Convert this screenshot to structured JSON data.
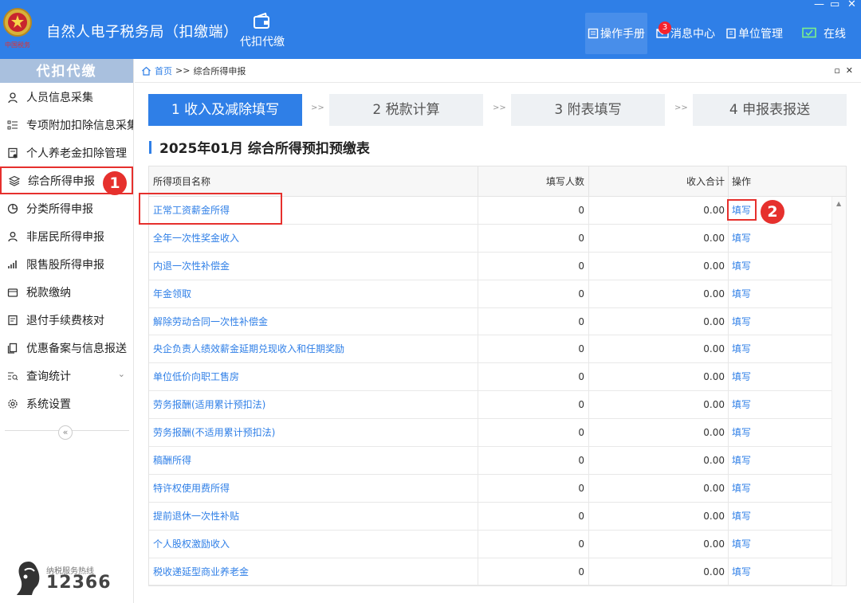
{
  "header": {
    "title": "自然人电子税务局（扣缴端）",
    "module_label": "代扣代缴",
    "manual_label": "操作手册",
    "message_label": "消息中心",
    "message_badge": "3",
    "unit_label": "单位管理",
    "online_label": "在线",
    "emblem_text": "中国税务"
  },
  "sidebar": {
    "title": "代扣代缴",
    "items": [
      {
        "label": "人员信息采集",
        "icon": "person-icon"
      },
      {
        "label": "专项附加扣除信息采集",
        "icon": "list-icon"
      },
      {
        "label": "个人养老金扣除管理",
        "icon": "pension-icon"
      },
      {
        "label": "综合所得申报",
        "icon": "layers-icon"
      },
      {
        "label": "分类所得申报",
        "icon": "pie-icon"
      },
      {
        "label": "非居民所得申报",
        "icon": "user-icon"
      },
      {
        "label": "限售股所得申报",
        "icon": "bar-chart-icon"
      },
      {
        "label": "税款缴纳",
        "icon": "wallet-icon"
      },
      {
        "label": "退付手续费核对",
        "icon": "document-icon"
      },
      {
        "label": "优惠备案与信息报送",
        "icon": "copy-icon"
      },
      {
        "label": "查询统计",
        "icon": "search-list-icon"
      },
      {
        "label": "系统设置",
        "icon": "gear-icon"
      }
    ],
    "collapse_glyph": "«",
    "hotline_label": "纳税服务热线",
    "hotline_number": "12366"
  },
  "markers": {
    "first": "1",
    "second": "2"
  },
  "breadcrumb": {
    "home": "首页",
    "separator": ">>",
    "current": "综合所得申报"
  },
  "steps": [
    {
      "label": "1 收入及减除填写",
      "active": true
    },
    {
      "label": "2 税款计算",
      "active": false
    },
    {
      "label": "3 附表填写",
      "active": false
    },
    {
      "label": "4 申报表报送",
      "active": false
    }
  ],
  "step_separator": ">>",
  "table": {
    "title": "2025年01月  综合所得预扣预缴表",
    "columns": [
      "所得项目名称",
      "填写人数",
      "收入合计",
      "操作"
    ],
    "rows": [
      {
        "name": "正常工资薪金所得",
        "count": "0",
        "income": "0.00",
        "action": "填写"
      },
      {
        "name": "全年一次性奖金收入",
        "count": "0",
        "income": "0.00",
        "action": "填写"
      },
      {
        "name": "内退一次性补偿金",
        "count": "0",
        "income": "0.00",
        "action": "填写"
      },
      {
        "name": "年金领取",
        "count": "0",
        "income": "0.00",
        "action": "填写"
      },
      {
        "name": "解除劳动合同一次性补偿金",
        "count": "0",
        "income": "0.00",
        "action": "填写"
      },
      {
        "name": "央企负责人绩效薪金延期兑现收入和任期奖励",
        "count": "0",
        "income": "0.00",
        "action": "填写"
      },
      {
        "name": "单位低价向职工售房",
        "count": "0",
        "income": "0.00",
        "action": "填写"
      },
      {
        "name": "劳务报酬(适用累计预扣法)",
        "count": "0",
        "income": "0.00",
        "action": "填写"
      },
      {
        "name": "劳务报酬(不适用累计预扣法)",
        "count": "0",
        "income": "0.00",
        "action": "填写"
      },
      {
        "name": "稿酬所得",
        "count": "0",
        "income": "0.00",
        "action": "填写"
      },
      {
        "name": "特许权使用费所得",
        "count": "0",
        "income": "0.00",
        "action": "填写"
      },
      {
        "name": "提前退休一次性补贴",
        "count": "0",
        "income": "0.00",
        "action": "填写"
      },
      {
        "name": "个人股权激励收入",
        "count": "0",
        "income": "0.00",
        "action": "填写"
      },
      {
        "name": "税收递延型商业养老金",
        "count": "0",
        "income": "0.00",
        "action": "填写"
      }
    ]
  },
  "colors": {
    "primary": "#2f7fe7",
    "highlight": "#e6302d",
    "sidebar_head": "#a9c0de"
  }
}
